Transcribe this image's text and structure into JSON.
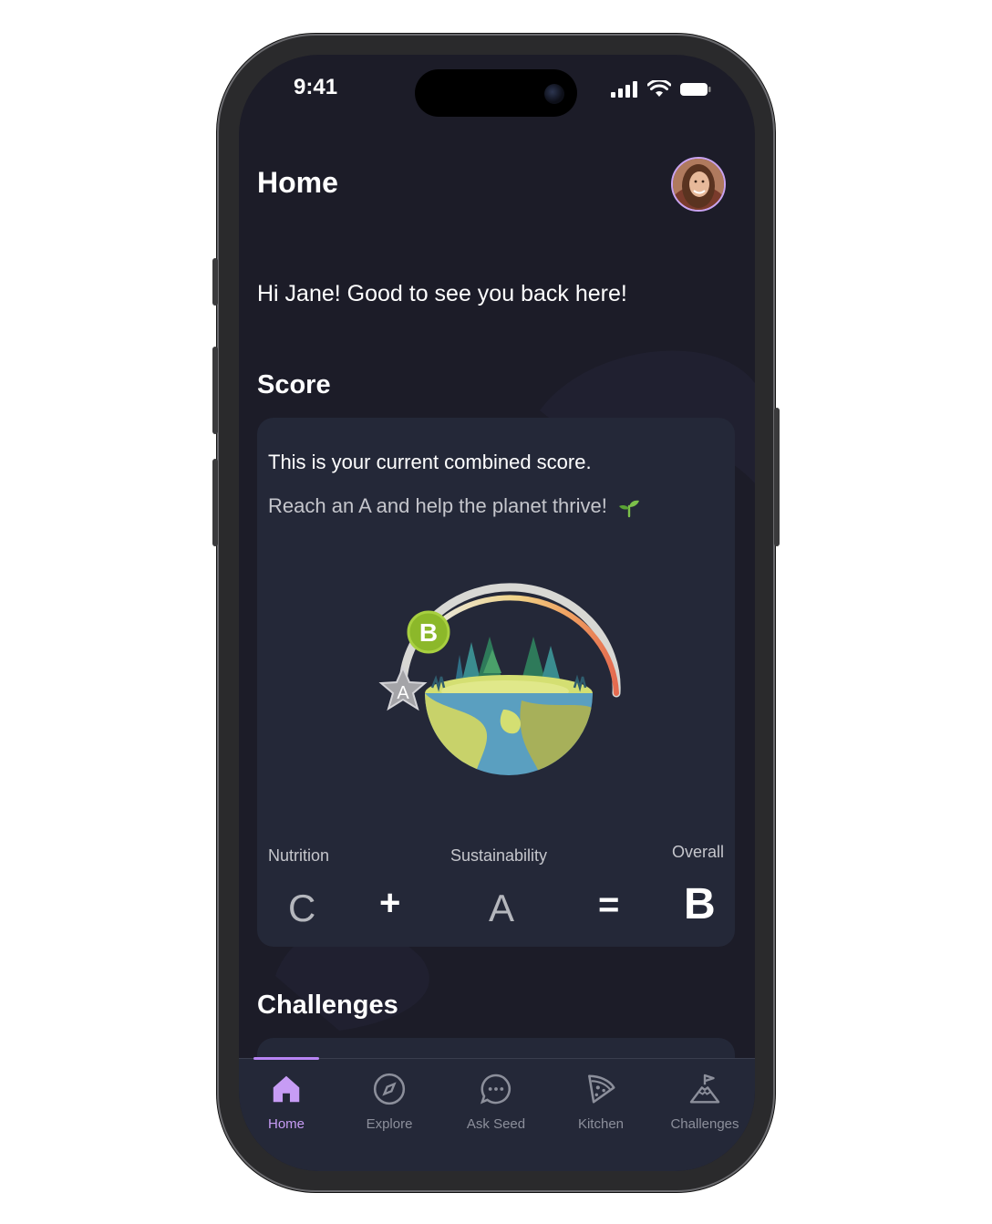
{
  "status_bar": {
    "time": "9:41"
  },
  "header": {
    "title": "Home"
  },
  "greeting": "Hi Jane! Good to see you back here!",
  "score": {
    "section_title": "Score",
    "card_title": "This is your current combined score.",
    "card_subtitle": "Reach an A and help the planet thrive!",
    "badge_grade": "B",
    "star_grade": "A",
    "nutrition_label": "Nutrition",
    "sustainability_label": "Sustainability",
    "overall_label": "Overall",
    "nutrition_grade": "C",
    "plus_op": "+",
    "sustainability_grade": "A",
    "equals_op": "=",
    "overall_grade": "B"
  },
  "challenges": {
    "section_title": "Challenges"
  },
  "tabbar": {
    "tabs": [
      {
        "label": "Home",
        "icon": "home-icon",
        "active": true
      },
      {
        "label": "Explore",
        "icon": "compass-icon",
        "active": false
      },
      {
        "label": "Ask Seed",
        "icon": "chat-icon",
        "active": false
      },
      {
        "label": "Kitchen",
        "icon": "pizza-icon",
        "active": false
      },
      {
        "label": "Challenges",
        "icon": "flag-mountain-icon",
        "active": false
      }
    ]
  },
  "colors": {
    "screen_bg": "#1c1c28",
    "card_bg": "#242838",
    "accent": "#c79cf5",
    "badge_green": "#8cb82a"
  }
}
